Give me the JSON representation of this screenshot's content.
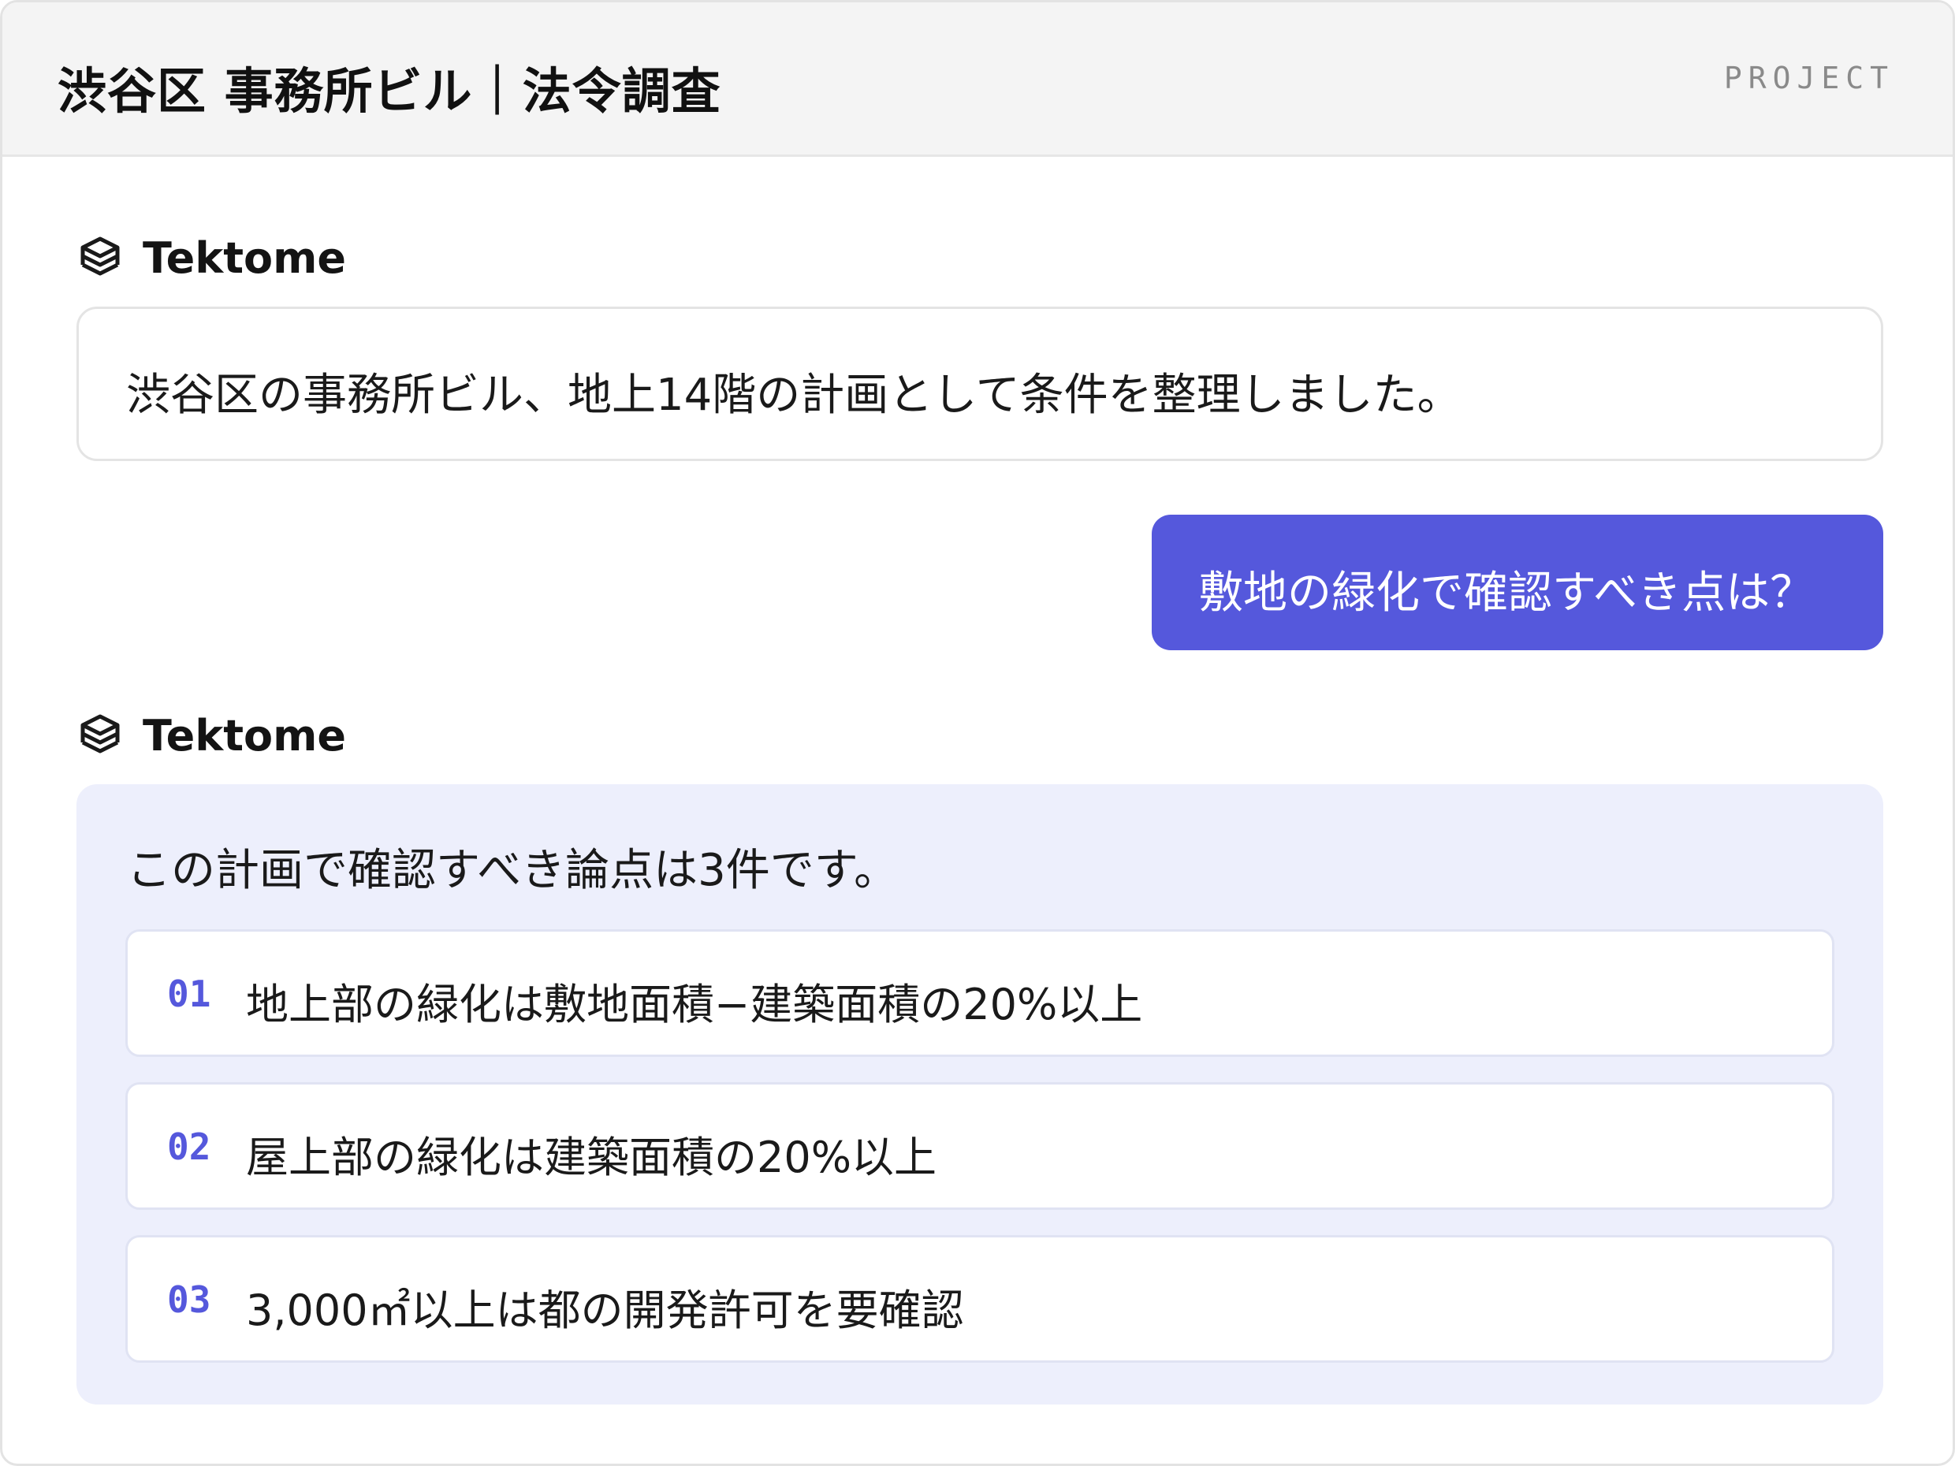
{
  "header": {
    "title": "渋谷区 事務所ビル｜法令調査",
    "tag": "PROJECT"
  },
  "conversation": {
    "assistant_name": "Tektome",
    "logo_icon": "layered-cube-logo-icon",
    "first_reply": "渋谷区の事務所ビル、地上14階の計画として条件を整理しました。",
    "user_question": "敷地の緑化で確認すべき点は？",
    "second_reply": {
      "intro": "この計画で確認すべき論点は3件です。",
      "items": [
        {
          "num": "01",
          "text": "地上部の緑化は敷地面積−建築面積の20%以上"
        },
        {
          "num": "02",
          "text": "屋上部の緑化は建築面積の20%以上"
        },
        {
          "num": "03",
          "text": "3,000㎡以上は都の開発許可を要確認"
        }
      ]
    }
  },
  "colors": {
    "accent": "#5558dc",
    "panel": "#edeffc",
    "header_bg": "#f4f4f4"
  }
}
